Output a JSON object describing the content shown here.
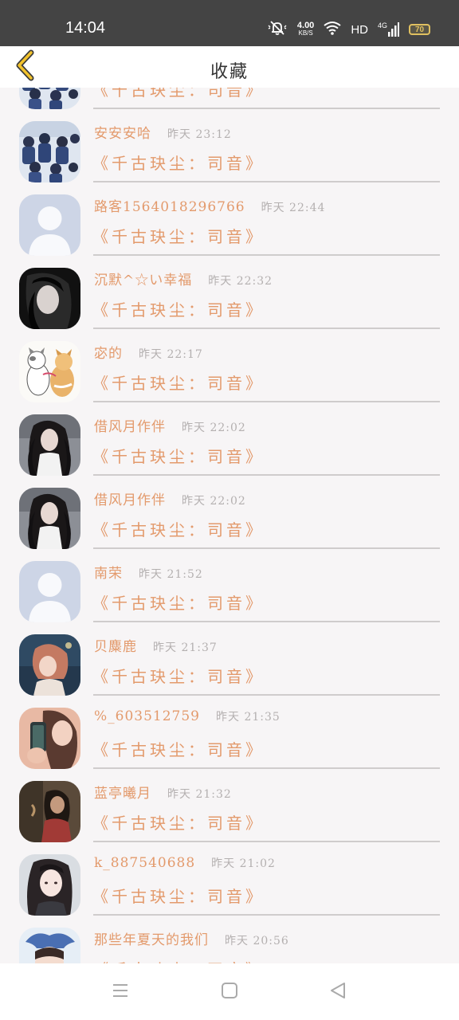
{
  "status_bar": {
    "time": "14:04",
    "net_speed_value": "4.00",
    "net_speed_unit": "KB/S",
    "hd": "HD",
    "network": "4G",
    "battery": "70"
  },
  "header": {
    "title": "收藏",
    "back_icon": "chevron-left-icon"
  },
  "items": [
    {
      "name": "",
      "time": "",
      "song": "《千古玦尘：司音》",
      "avatar": "crowd"
    },
    {
      "name": "安安安哈",
      "time": "昨天 23:12",
      "song": "《千古玦尘：司音》",
      "avatar": "crowd"
    },
    {
      "name": "路客1564018296766",
      "time": "昨天 22:44",
      "song": "《千古玦尘：司音》",
      "avatar": "default"
    },
    {
      "name": "沉默^☆い幸福",
      "time": "昨天 22:32",
      "song": "《千古玦尘：司音》",
      "avatar": "dark-girl"
    },
    {
      "name": "宓的",
      "time": "昨天 22:17",
      "song": "《千古玦尘：司音》",
      "avatar": "cats"
    },
    {
      "name": "借风月作伴",
      "time": "昨天 22:02",
      "song": "《千古玦尘：司音》",
      "avatar": "hair-girl"
    },
    {
      "name": "借风月作伴",
      "time": "昨天 22:02",
      "song": "《千古玦尘：司音》",
      "avatar": "hair-girl"
    },
    {
      "name": "南荣",
      "time": "昨天 21:52",
      "song": "《千古玦尘：司音》",
      "avatar": "default"
    },
    {
      "name": "贝麋鹿",
      "time": "昨天 21:37",
      "song": "《千古玦尘：司音》",
      "avatar": "painted-girl"
    },
    {
      "name": "%_603512759",
      "time": "昨天 21:35",
      "song": "《千古玦尘：司音》",
      "avatar": "phone-girl"
    },
    {
      "name": "蓝亭曦月",
      "time": "昨天 21:32",
      "song": "《千古玦尘：司音》",
      "avatar": "sepia-girl"
    },
    {
      "name": "k_887540688",
      "time": "昨天 21:02",
      "song": "《千古玦尘：司音》",
      "avatar": "bright-girl"
    },
    {
      "name": "那些年夏天的我们",
      "time": "昨天 20:56",
      "song": "《千古玦尘：司音》",
      "avatar": "stitch"
    }
  ],
  "nav": {
    "menu_icon": "menu-icon",
    "home_icon": "home-square-icon",
    "back_icon": "back-triangle-icon"
  }
}
